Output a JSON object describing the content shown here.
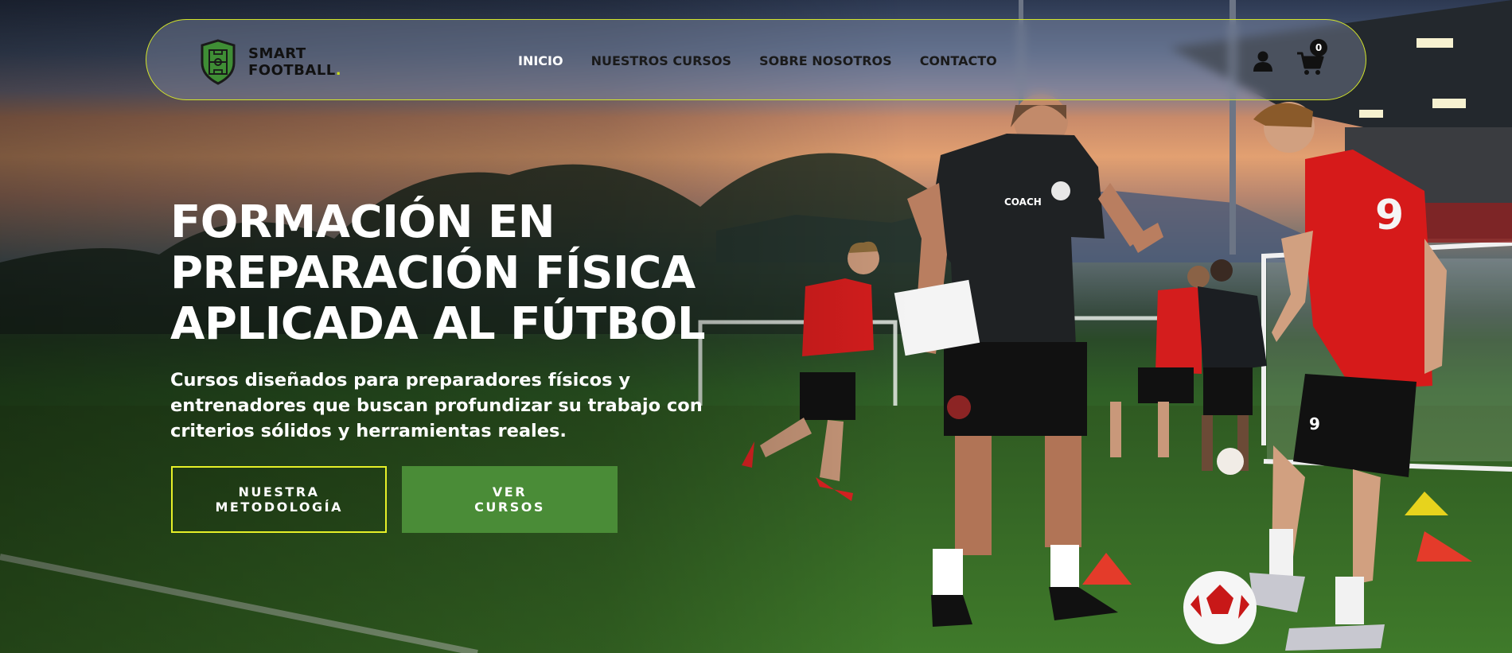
{
  "brand": {
    "name_line1": "SMART",
    "name_line2": "FOOTBALL",
    "name_dot": ".",
    "logo_icon": "shield-pitch-icon",
    "accent_color": "#c9dd1d"
  },
  "nav": {
    "links": [
      {
        "label": "INICIO",
        "active": true
      },
      {
        "label": "NUESTROS CURSOS",
        "active": false
      },
      {
        "label": "SOBRE NOSOTROS",
        "active": false
      },
      {
        "label": "CONTACTO",
        "active": false
      }
    ],
    "user_icon": "user-icon",
    "cart_icon": "cart-icon",
    "cart_count": "0"
  },
  "hero": {
    "title_lines": [
      "FORMACIÓN EN",
      "PREPARACIÓN FÍSICA",
      "APLICADA AL FÚTBOL"
    ],
    "subtitle": "Cursos diseñados para preparadores físicos y entrenadores que buscan profundizar su trabajo con criterios sólidos y herramientas reales.",
    "buttons": [
      {
        "label": "NUESTRA METODOLOGÍA",
        "style": "outline"
      },
      {
        "label": "VER CURSOS",
        "style": "solid"
      }
    ]
  },
  "colors": {
    "button_solid": "#4a8c37",
    "button_outline_border": "#e6f028",
    "nav_border": "#d4e62a"
  }
}
